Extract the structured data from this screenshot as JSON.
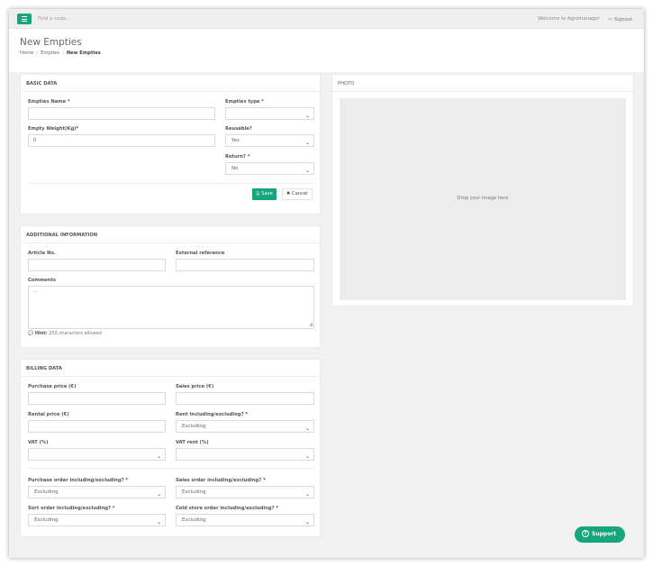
{
  "topbar": {
    "search_placeholder": "Find a code...",
    "welcome": "Welcome to Agromanager",
    "signout": "Signout"
  },
  "header": {
    "title": "New Empties",
    "breadcrumb": [
      "Home",
      "Empties",
      "New Empties"
    ]
  },
  "basic": {
    "title": "BASIC DATA",
    "empties_name_label": "Empties Name *",
    "empties_name_value": "",
    "empties_type_label": "Empties type *",
    "empties_type_value": "",
    "weight_label": "Empty Weight(Kg)*",
    "weight_value": "0",
    "reusable_label": "Reusable?",
    "reusable_value": "Yes",
    "return_label": "Return? *",
    "return_value": "No",
    "save_label": "Save",
    "cancel_label": "Cancel"
  },
  "photo": {
    "title": "PHOTO",
    "drop_text": "Drop your image here"
  },
  "additional": {
    "title": "ADDITIONAL INFORMATION",
    "article_label": "Article No.",
    "article_value": "",
    "external_label": "External reference",
    "external_value": "",
    "comments_label": "Comments",
    "comments_value": "--",
    "hint_label": "Hint:",
    "hint_text": "250 characters allowed"
  },
  "billing": {
    "title": "BILLING DATA",
    "purchase_price_label": "Purchase price (€)",
    "purchase_price_value": "",
    "sales_price_label": "Sales price (€)",
    "sales_price_value": "",
    "rental_price_label": "Rental price (€)",
    "rental_price_value": "",
    "rent_incl_label": "Rent including/excluding? *",
    "rent_incl_value": "Excluding",
    "vat_label": "VAT (%)",
    "vat_value": "",
    "vat_rent_label": "VAT rent (%)",
    "vat_rent_value": "",
    "purchase_order_label": "Purchase order including/excluding? *",
    "purchase_order_value": "Excluding",
    "sales_order_label": "Sales order including/excluding? *",
    "sales_order_value": "Excluding",
    "sort_order_label": "Sort order including/excluding? *",
    "sort_order_value": "Excluding",
    "cold_store_label": "Cold store order including/excluding? *",
    "cold_store_value": "Excluding"
  },
  "support": {
    "label": "Support"
  },
  "icons": {
    "menu": "menu-icon",
    "signout": "signout-icon",
    "caret": "chevron-down-icon",
    "save": "floppy-icon",
    "cancel": "close-icon",
    "hint": "comment-icon",
    "support": "question-circle-icon"
  },
  "colors": {
    "accent": "#17a57e",
    "background": "#f1f1f1",
    "panel": "#ffffff"
  }
}
